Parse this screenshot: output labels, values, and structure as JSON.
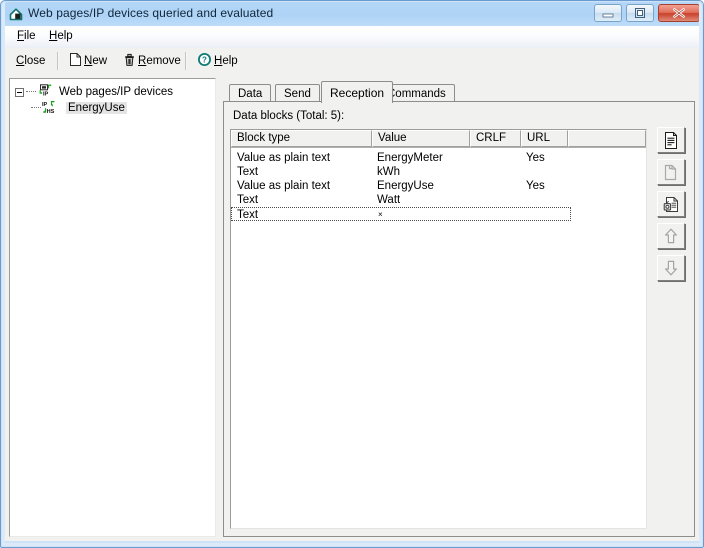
{
  "window": {
    "title": "Web pages/IP devices queried and evaluated",
    "app_icon": "house-icon",
    "controls": {
      "minimize": "minimize-button",
      "maximize": "restore-button",
      "close": "close-button"
    },
    "accent_titlebar": "#b0d4f7",
    "accent_close": "#c9412c"
  },
  "menubar": {
    "items": [
      {
        "label": "File",
        "mnemonic": "F"
      },
      {
        "label": "Help",
        "mnemonic": "H"
      }
    ]
  },
  "toolbar": {
    "buttons": [
      {
        "label": "Close",
        "mnemonic": "C",
        "icon": "none"
      },
      {
        "label": "New",
        "mnemonic": "N",
        "icon": "document-icon"
      },
      {
        "label": "Remove",
        "mnemonic": "R",
        "icon": "trash-icon"
      },
      {
        "label": "Help",
        "mnemonic": "H",
        "icon": "help-circle-icon"
      }
    ]
  },
  "tree": {
    "root": {
      "label": "Web pages/IP devices",
      "icon": "ip-device-root-icon",
      "expanded": true
    },
    "children": [
      {
        "label": "EnergyUse",
        "icon": "ip-hs-icon",
        "selected": true
      }
    ]
  },
  "tabs": [
    {
      "label": "Data",
      "active": false
    },
    {
      "label": "Send",
      "active": false
    },
    {
      "label": "Reception",
      "active": true
    },
    {
      "label": "Commands",
      "active": false
    }
  ],
  "reception": {
    "blocks_label": "Data blocks (Total: 5):",
    "total": 5,
    "columns": [
      {
        "key": "block_type",
        "label": "Block type"
      },
      {
        "key": "value",
        "label": "Value"
      },
      {
        "key": "crlf",
        "label": "CRLF"
      },
      {
        "key": "url",
        "label": "URL"
      },
      {
        "key": "spare",
        "label": ""
      }
    ],
    "rows": [
      {
        "block_type": "Value as plain text",
        "value": "EnergyMeter",
        "crlf": "",
        "url": "Yes",
        "focused": false
      },
      {
        "block_type": "Text",
        "value": "kWh",
        "crlf": "",
        "url": "",
        "focused": false
      },
      {
        "block_type": "Value as plain text",
        "value": "EnergyUse",
        "crlf": "",
        "url": "Yes",
        "focused": false
      },
      {
        "block_type": "Text",
        "value": "Watt",
        "crlf": "",
        "url": "",
        "focused": false
      },
      {
        "block_type": "Text",
        "value": "×",
        "crlf": "",
        "url": "",
        "focused": true
      }
    ],
    "side_tools": [
      {
        "name": "new-block-button",
        "icon": "document-lines-icon",
        "enabled": true
      },
      {
        "name": "copy-block-button",
        "icon": "copy-icon",
        "enabled": false
      },
      {
        "name": "edit-block-button",
        "icon": "edit-properties-icon",
        "enabled": true
      },
      {
        "name": "move-up-button",
        "icon": "arrow-up-icon",
        "enabled": false
      },
      {
        "name": "move-down-button",
        "icon": "arrow-down-icon",
        "enabled": false
      }
    ]
  }
}
